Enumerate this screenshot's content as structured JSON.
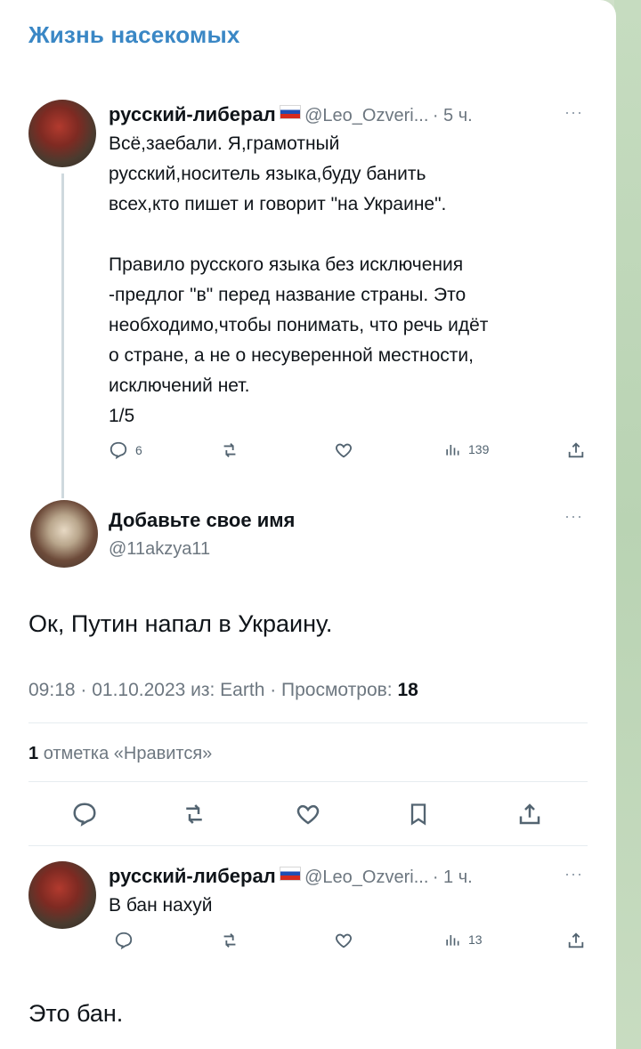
{
  "channel": {
    "title": "Жизнь насекомых"
  },
  "tweet1": {
    "author": "русский-либерал",
    "handle": "@Leo_Ozveri...",
    "time": "· 5 ч.",
    "menu": "···",
    "lines": [
      "Всё,заебали. Я,грамотный",
      "русский,носитель языка,буду банить",
      "всех,кто пишет и говорит \"на Украине\".",
      "Правило русского языка без исключения",
      "-предлог \"в\" перед название страны. Это",
      "необходимо,чтобы понимать, что речь идёт",
      "о стране, а не о несуверенной местности,",
      "исключений нет.",
      "1/5"
    ],
    "replies": "6",
    "views": "139"
  },
  "reply": {
    "author": "Добавьте свое имя",
    "handle": "@11akzya11",
    "menu": "···",
    "text": "Ок, Путин напал в Украину.",
    "meta": "09:18 · 01.10.2023 из: Earth · Просмотров:",
    "views": "18",
    "likes_count": "1",
    "likes_label": "отметка «Нравится»"
  },
  "tweet2": {
    "author": "русский-либерал",
    "handle": "@Leo_Ozveri...",
    "time": "· 1 ч.",
    "menu": "···",
    "text": "В бан нахуй",
    "views": "13"
  },
  "caption": "Это бан.",
  "colors": {
    "accent": "#3a87c5",
    "muted": "#6d7780",
    "background": "#cfe0c9"
  }
}
